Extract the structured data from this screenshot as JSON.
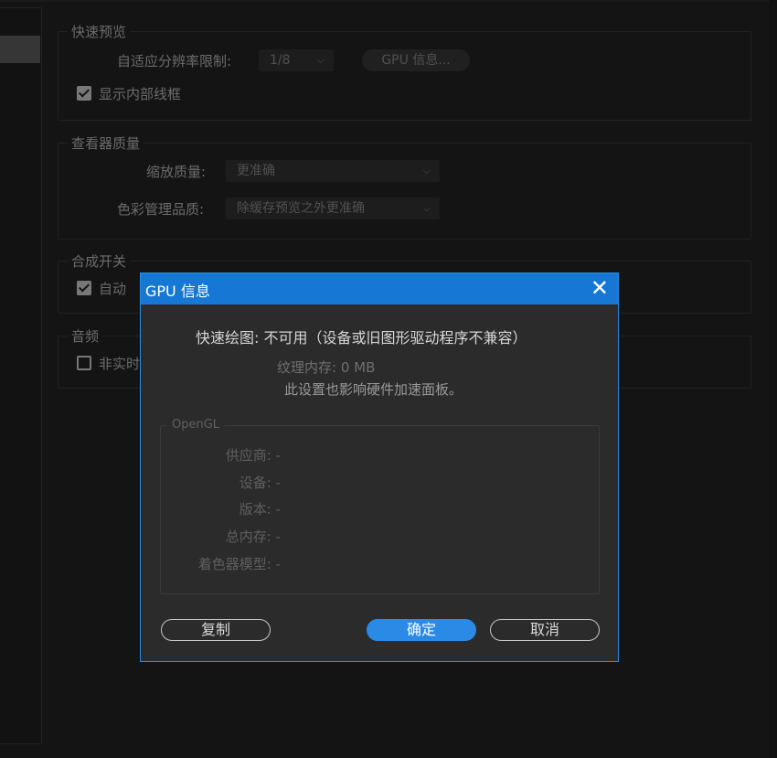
{
  "background": {
    "quick_preview": {
      "legend": "快速预览",
      "adaptive_res_label": "自适应分辨率限制:",
      "adaptive_res_value": "1/8",
      "gpu_info_button": "GPU 信息...",
      "show_wireframe_label": "显示内部线框"
    },
    "viewer_quality": {
      "legend": "查看器质量",
      "zoom_quality_label": "缩放质量:",
      "zoom_quality_value": "更准确",
      "color_mgmt_label": "色彩管理品质:",
      "color_mgmt_value": "除缓存预览之外更准确"
    },
    "composite_switch": {
      "legend": "合成开关",
      "auto_label": "自动"
    },
    "audio": {
      "legend": "音频",
      "nonrealtime_label": "非实时"
    }
  },
  "dialog": {
    "title": "GPU 信息",
    "fast_draw": "快速绘图:  不可用（设备或旧图形驱动程序不兼容）",
    "texture_memory": "纹理内存:  0 MB",
    "affects_note": "此设置也影响硬件加速面板。",
    "opengl_legend": "OpenGL",
    "opengl_rows": [
      "供应商: -",
      "设备: -",
      "版本: -",
      "总内存: -",
      "着色器模型: -"
    ],
    "copy_button": "复制",
    "ok_button": "确定",
    "cancel_button": "取消"
  },
  "colors": {
    "title_bar": "#1678d4",
    "primary_button": "#2b8ae5",
    "dialog_bg": "#2b2b2b"
  }
}
